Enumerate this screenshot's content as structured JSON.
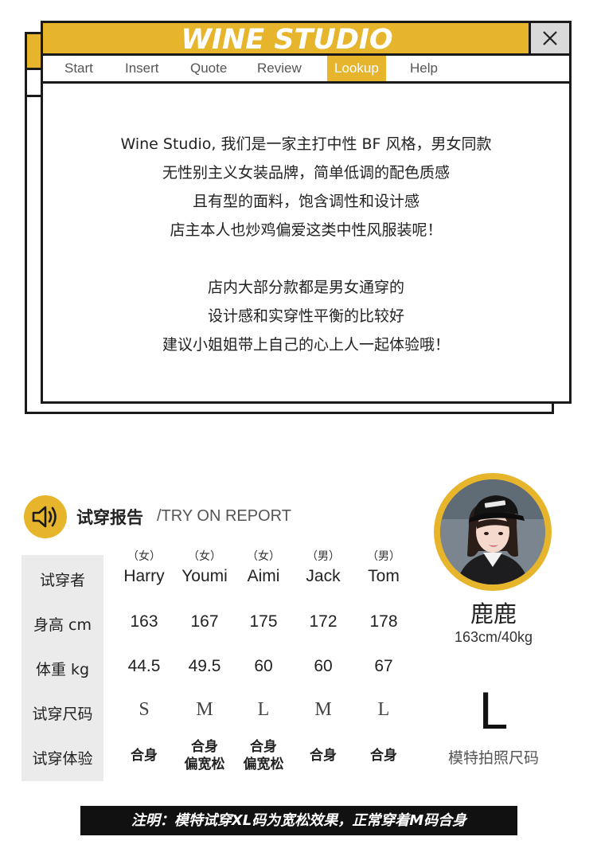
{
  "window": {
    "title": "WINE STUDIO",
    "accent_color": "#e7b52b",
    "close_icon": "close-icon",
    "menu": [
      {
        "label": "Start"
      },
      {
        "label": "Insert"
      },
      {
        "label": "Quote"
      },
      {
        "label": "Review"
      },
      {
        "label": "Lookup",
        "active": true
      },
      {
        "label": "Help"
      }
    ],
    "paragraphs": [
      [
        "Wine Studio, 我们是一家主打中性 BF 风格，男女同款",
        "无性别主义女装品牌，简单低调的配色质感",
        "且有型的面料，饱含调性和设计感",
        "店主本人也炒鸡偏爱这类中性风服装呢！"
      ],
      [
        "店内大部分款都是男女通穿的",
        "设计感和实穿性平衡的比较好",
        "建议小姐姐带上自己的心上人一起体验哦！"
      ]
    ]
  },
  "report": {
    "icon": "speaker-icon",
    "title": "试穿报告",
    "subtitle": "/TRY ON REPORT",
    "row_labels": [
      "试穿者",
      "身高 cm",
      "体重 kg",
      "试穿尺码",
      "试穿体验"
    ],
    "people": [
      {
        "gender": "（女）",
        "name": "Harry",
        "height": "163",
        "weight": "44.5",
        "size": "S",
        "experience": [
          "合身"
        ]
      },
      {
        "gender": "（女）",
        "name": "Youmi",
        "height": "167",
        "weight": "49.5",
        "size": "M",
        "experience": [
          "合身",
          "偏宽松"
        ]
      },
      {
        "gender": "（女）",
        "name": "Aimi",
        "height": "175",
        "weight": "60",
        "size": "L",
        "experience": [
          "合身",
          "偏宽松"
        ]
      },
      {
        "gender": "（男）",
        "name": "Jack",
        "height": "172",
        "weight": "60",
        "size": "M",
        "experience": [
          "合身"
        ]
      },
      {
        "gender": "（男）",
        "name": "Tom",
        "height": "178",
        "weight": "67",
        "size": "L",
        "experience": [
          "合身"
        ]
      }
    ]
  },
  "model": {
    "name": "鹿鹿",
    "stats": "163cm/40kg",
    "size": "L",
    "size_label": "模特拍照尺码"
  },
  "note": "注明：模特试穿XL码为宽松效果，正常穿着M码合身"
}
